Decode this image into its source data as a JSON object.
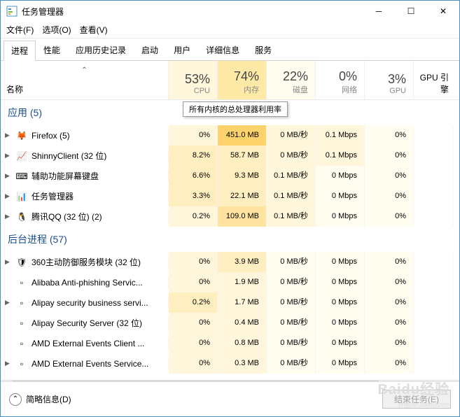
{
  "window": {
    "title": "任务管理器"
  },
  "menu": {
    "file": "文件(F)",
    "options": "选项(O)",
    "view": "查看(V)"
  },
  "tabs": [
    "进程",
    "性能",
    "应用历史记录",
    "启动",
    "用户",
    "详细信息",
    "服务"
  ],
  "columns": {
    "name": "名称",
    "cpu": {
      "pct": "53%",
      "label": "CPU"
    },
    "mem": {
      "pct": "74%",
      "label": "内存"
    },
    "disk": {
      "pct": "22%",
      "label": "磁盘"
    },
    "net": {
      "pct": "0%",
      "label": "网络"
    },
    "gpu": {
      "pct": "3%",
      "label": "GPU"
    },
    "gpu_engine": "GPU 引擎"
  },
  "tooltip": "所有内核的总处理器利用率",
  "groups": [
    {
      "title": "应用 (5)",
      "rows": [
        {
          "exp": true,
          "icon": "🦊",
          "name": "Firefox (5)",
          "cpu": "0%",
          "mem": "451.0 MB",
          "disk": "0 MB/秒",
          "net": "0.1 Mbps",
          "gpu": "0%",
          "heat": [
            1,
            4,
            1,
            1,
            0
          ]
        },
        {
          "exp": true,
          "icon": "📈",
          "name": "ShinnyClient (32 位)",
          "cpu": "8.2%",
          "mem": "58.7 MB",
          "disk": "0 MB/秒",
          "net": "0.1 Mbps",
          "gpu": "0%",
          "heat": [
            2,
            2,
            1,
            1,
            0
          ]
        },
        {
          "exp": true,
          "icon": "⌨",
          "name": "辅助功能屏幕键盘",
          "cpu": "6.6%",
          "mem": "9.3 MB",
          "disk": "0.1 MB/秒",
          "net": "0 Mbps",
          "gpu": "0%",
          "heat": [
            2,
            2,
            1,
            0,
            0
          ]
        },
        {
          "exp": true,
          "icon": "📊",
          "name": "任务管理器",
          "cpu": "3.3%",
          "mem": "22.1 MB",
          "disk": "0.1 MB/秒",
          "net": "0 Mbps",
          "gpu": "0%",
          "heat": [
            2,
            2,
            1,
            0,
            0
          ]
        },
        {
          "exp": true,
          "icon": "🐧",
          "name": "腾讯QQ (32 位) (2)",
          "cpu": "0.2%",
          "mem": "109.0 MB",
          "disk": "0.1 MB/秒",
          "net": "0 Mbps",
          "gpu": "0%",
          "heat": [
            1,
            3,
            1,
            0,
            0
          ]
        }
      ]
    },
    {
      "title": "后台进程 (57)",
      "rows": [
        {
          "exp": true,
          "icon": "🛡",
          "name": "360主动防御服务模块 (32 位)",
          "cpu": "0%",
          "mem": "3.9 MB",
          "disk": "0 MB/秒",
          "net": "0 Mbps",
          "gpu": "0%",
          "heat": [
            1,
            2,
            0,
            0,
            0
          ]
        },
        {
          "exp": false,
          "icon": "▫",
          "name": "Alibaba Anti-phishing Servic...",
          "cpu": "0%",
          "mem": "1.9 MB",
          "disk": "0 MB/秒",
          "net": "0 Mbps",
          "gpu": "0%",
          "heat": [
            1,
            1,
            0,
            0,
            0
          ]
        },
        {
          "exp": true,
          "icon": "▫",
          "name": "Alipay security business servi...",
          "cpu": "0.2%",
          "mem": "1.7 MB",
          "disk": "0 MB/秒",
          "net": "0 Mbps",
          "gpu": "0%",
          "heat": [
            2,
            1,
            0,
            0,
            0
          ]
        },
        {
          "exp": false,
          "icon": "▫",
          "name": "Alipay Security Server (32 位)",
          "cpu": "0%",
          "mem": "0.4 MB",
          "disk": "0 MB/秒",
          "net": "0 Mbps",
          "gpu": "0%",
          "heat": [
            1,
            1,
            0,
            0,
            0
          ]
        },
        {
          "exp": false,
          "icon": "▫",
          "name": "AMD External Events Client ...",
          "cpu": "0%",
          "mem": "0.8 MB",
          "disk": "0 MB/秒",
          "net": "0 Mbps",
          "gpu": "0%",
          "heat": [
            1,
            1,
            0,
            0,
            0
          ]
        },
        {
          "exp": true,
          "icon": "▫",
          "name": "AMD External Events Service...",
          "cpu": "0%",
          "mem": "0.3 MB",
          "disk": "0 MB/秒",
          "net": "0 Mbps",
          "gpu": "0%",
          "heat": [
            1,
            1,
            0,
            0,
            0
          ]
        }
      ]
    }
  ],
  "footer": {
    "less": "简略信息(D)",
    "end": "结束任务(E)"
  },
  "watermark": {
    "main": "Baidu经验",
    "sub": "jingyan.baidu.com"
  }
}
